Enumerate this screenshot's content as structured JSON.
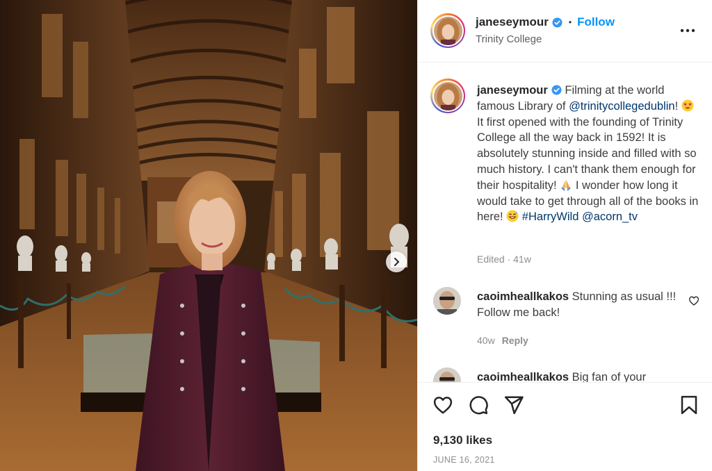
{
  "post": {
    "username": "janeseymour",
    "follow_label": "Follow",
    "separator": "•",
    "location": "Trinity College"
  },
  "caption": {
    "username": "janeseymour",
    "text_1": "Filming at the world famous Library of ",
    "mention_1": "@trinitycollegedublin",
    "text_2": "!",
    "text_3": " It first opened with the founding of Trinity College all the way back in 1592! It is absolutely stunning inside and filled with so much history. I can't thank them enough for their hospitality! ",
    "text_4": " I wonder how long it would take to get through all of the books in here! ",
    "hashtag": "#HarryWild",
    "mention_2": "@acorn_tv",
    "edited_time": "Edited · 41w"
  },
  "comments": [
    {
      "username": "caoimheallkakos",
      "text": "Stunning as usual !!! Follow me back!",
      "time": "40w",
      "reply_label": "Reply"
    },
    {
      "username": "caoimheallkakos",
      "text": "Big fan of your"
    }
  ],
  "footer": {
    "likes": "9,130 likes",
    "date": "JUNE 16, 2021"
  },
  "icons": {
    "verified": "verified-badge-icon",
    "more": "more-options-icon",
    "like": "heart-icon",
    "comment": "comment-bubble-icon",
    "share": "paper-plane-icon",
    "save": "bookmark-icon",
    "carousel": "chevron-right-icon"
  },
  "colors": {
    "accent": "#0095f6",
    "verified": "#3897f0",
    "link": "#00376b",
    "muted": "#8e8e8e"
  }
}
